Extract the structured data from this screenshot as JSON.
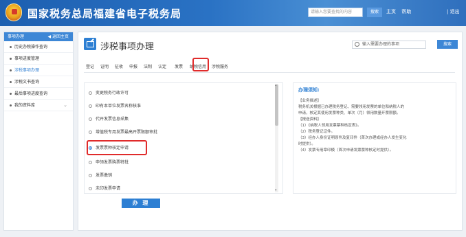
{
  "header": {
    "site_title": "国家税务总局福建省电子税务局",
    "search_placeholder": "请输入您要查找的内容",
    "search_button": "搜索",
    "links": [
      "主页",
      "帮助"
    ],
    "logout": "| 退出"
  },
  "sidebar": {
    "head_label": "事项办理",
    "back_label": "◀ 返回主页",
    "items": [
      {
        "label": "历史办税操作查询"
      },
      {
        "label": "事项进度管理"
      },
      {
        "label": "涉税事项办理"
      },
      {
        "label": "涉税文书查询"
      },
      {
        "label": "最后事项进度查询"
      },
      {
        "label": "我的资料库"
      }
    ]
  },
  "main": {
    "title": "涉税事项办理",
    "search_placeholder": "输入需要办理的事项",
    "search_button": "搜索",
    "tabs": [
      "登记",
      "证明",
      "征收",
      "申报",
      "法制",
      "认定",
      "发票",
      "纳税信用",
      "涉税服务"
    ],
    "active_tab": "发票",
    "list_items": [
      "变更税务行政许可",
      "印有本单位发票名称核准",
      "代开发票信息采集",
      "增值税专用发票最高开票限额审批",
      "发票票种核定申请",
      "申领发票购票特批",
      "发票缴销",
      "未印发票申请"
    ],
    "selected_item": "发票票种核定申请",
    "handle_button": "办 理"
  },
  "guide": {
    "title": "办理须知:",
    "lines": [
      "【业务描述】",
      "税务机关根据已办理税务登记、需要领用发票的单位和纳税人的",
      "申请，核定其使用发票种类、单次（月）领用数量开票限额。",
      "【报送资料】",
      "（1）《纳税人领用发票票种核定表》。",
      "（2）税务登记证件。",
      "（3）经办人身份证明原件及复印件（首次办理或经办人发生变化",
      "时提供）。",
      "（4）发票专用章印模（首次申请发票票种核定时提供）。"
    ]
  },
  "colors": {
    "brand_blue": "#2d7fd3",
    "highlight_red": "#e02b2b",
    "header_blue": "#1d5fb0"
  }
}
